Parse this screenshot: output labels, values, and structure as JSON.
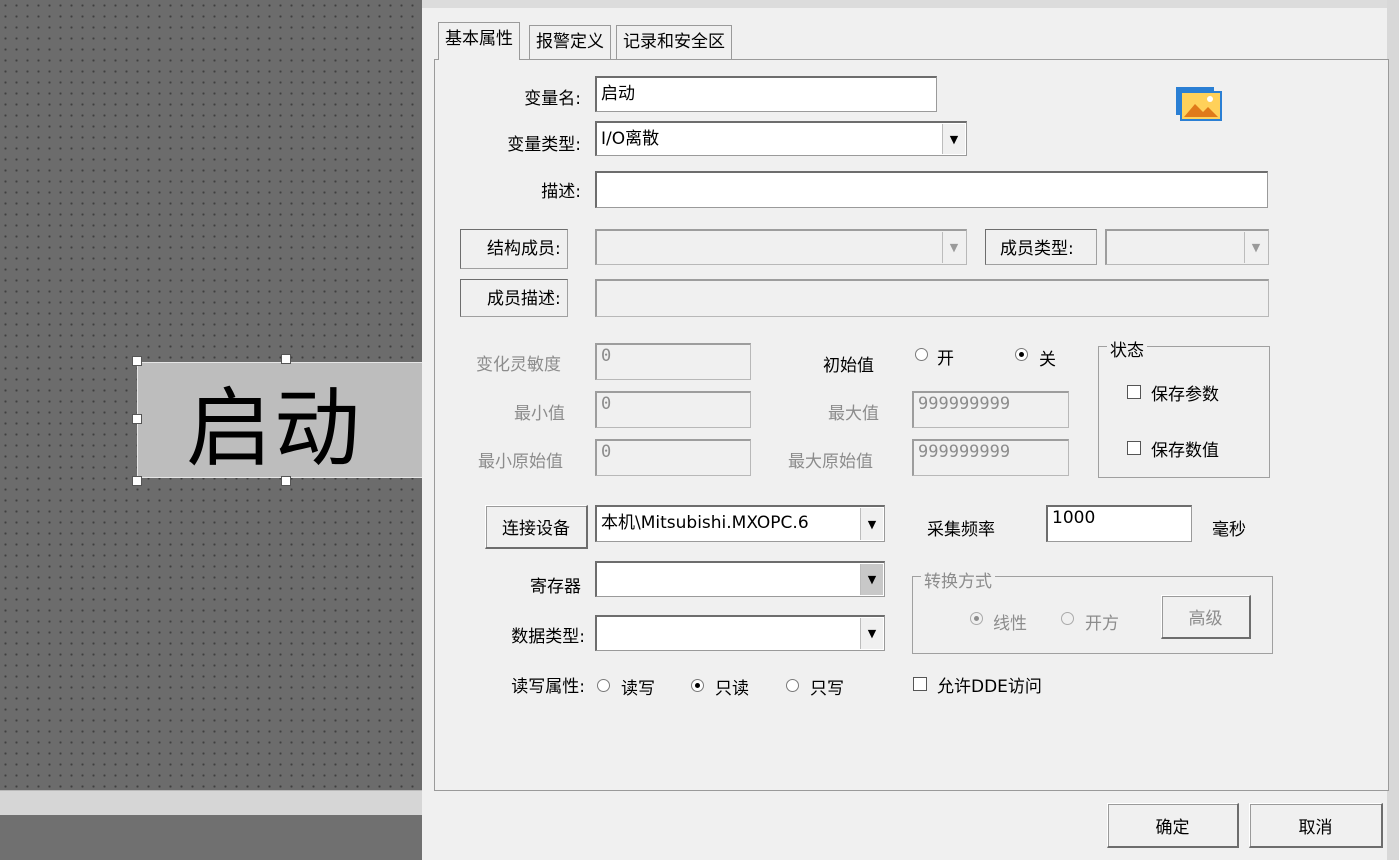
{
  "canvas": {
    "button_label": "启动"
  },
  "tabs": [
    {
      "label": "基本属性"
    },
    {
      "label": "报警定义"
    },
    {
      "label": "记录和安全区"
    }
  ],
  "form": {
    "var_name_label": "变量名:",
    "var_name_value": "启动",
    "var_type_label": "变量类型:",
    "var_type_value": "I/O离散",
    "desc_label": "描述:",
    "desc_value": "",
    "struct_member_label": "结构成员:",
    "member_type_label": "成员类型:",
    "member_desc_label": "成员描述:",
    "sensitivity_label": "变化灵敏度",
    "sensitivity_value": "0",
    "min_label": "最小值",
    "min_value": "0",
    "raw_min_label": "最小原始值",
    "raw_min_value": "0",
    "initial_label": "初始值",
    "initial_on": "开",
    "initial_off": "关",
    "max_label": "最大值",
    "max_value": "999999999",
    "raw_max_label": "最大原始值",
    "raw_max_value": "999999999",
    "state_group": "状态",
    "save_params": "保存参数",
    "save_values": "保存数值",
    "connect_device_button": "连接设备",
    "device_value": "本机\\Mitsubishi.MXOPC.6",
    "freq_label": "采集频率",
    "freq_value": "1000",
    "freq_unit": "毫秒",
    "register_label": "寄存器",
    "register_value": "",
    "conversion_group": "转换方式",
    "linear": "线性",
    "sqrt": "开方",
    "advanced_button": "高级",
    "data_type_label": "数据类型:",
    "data_type_value": "",
    "rw_label": "读写属性:",
    "rw_readwrite": "读写",
    "rw_readonly": "只读",
    "rw_writeonly": "只写",
    "allow_dde": "允许DDE访问"
  },
  "footer": {
    "ok": "确定",
    "cancel": "取消"
  }
}
